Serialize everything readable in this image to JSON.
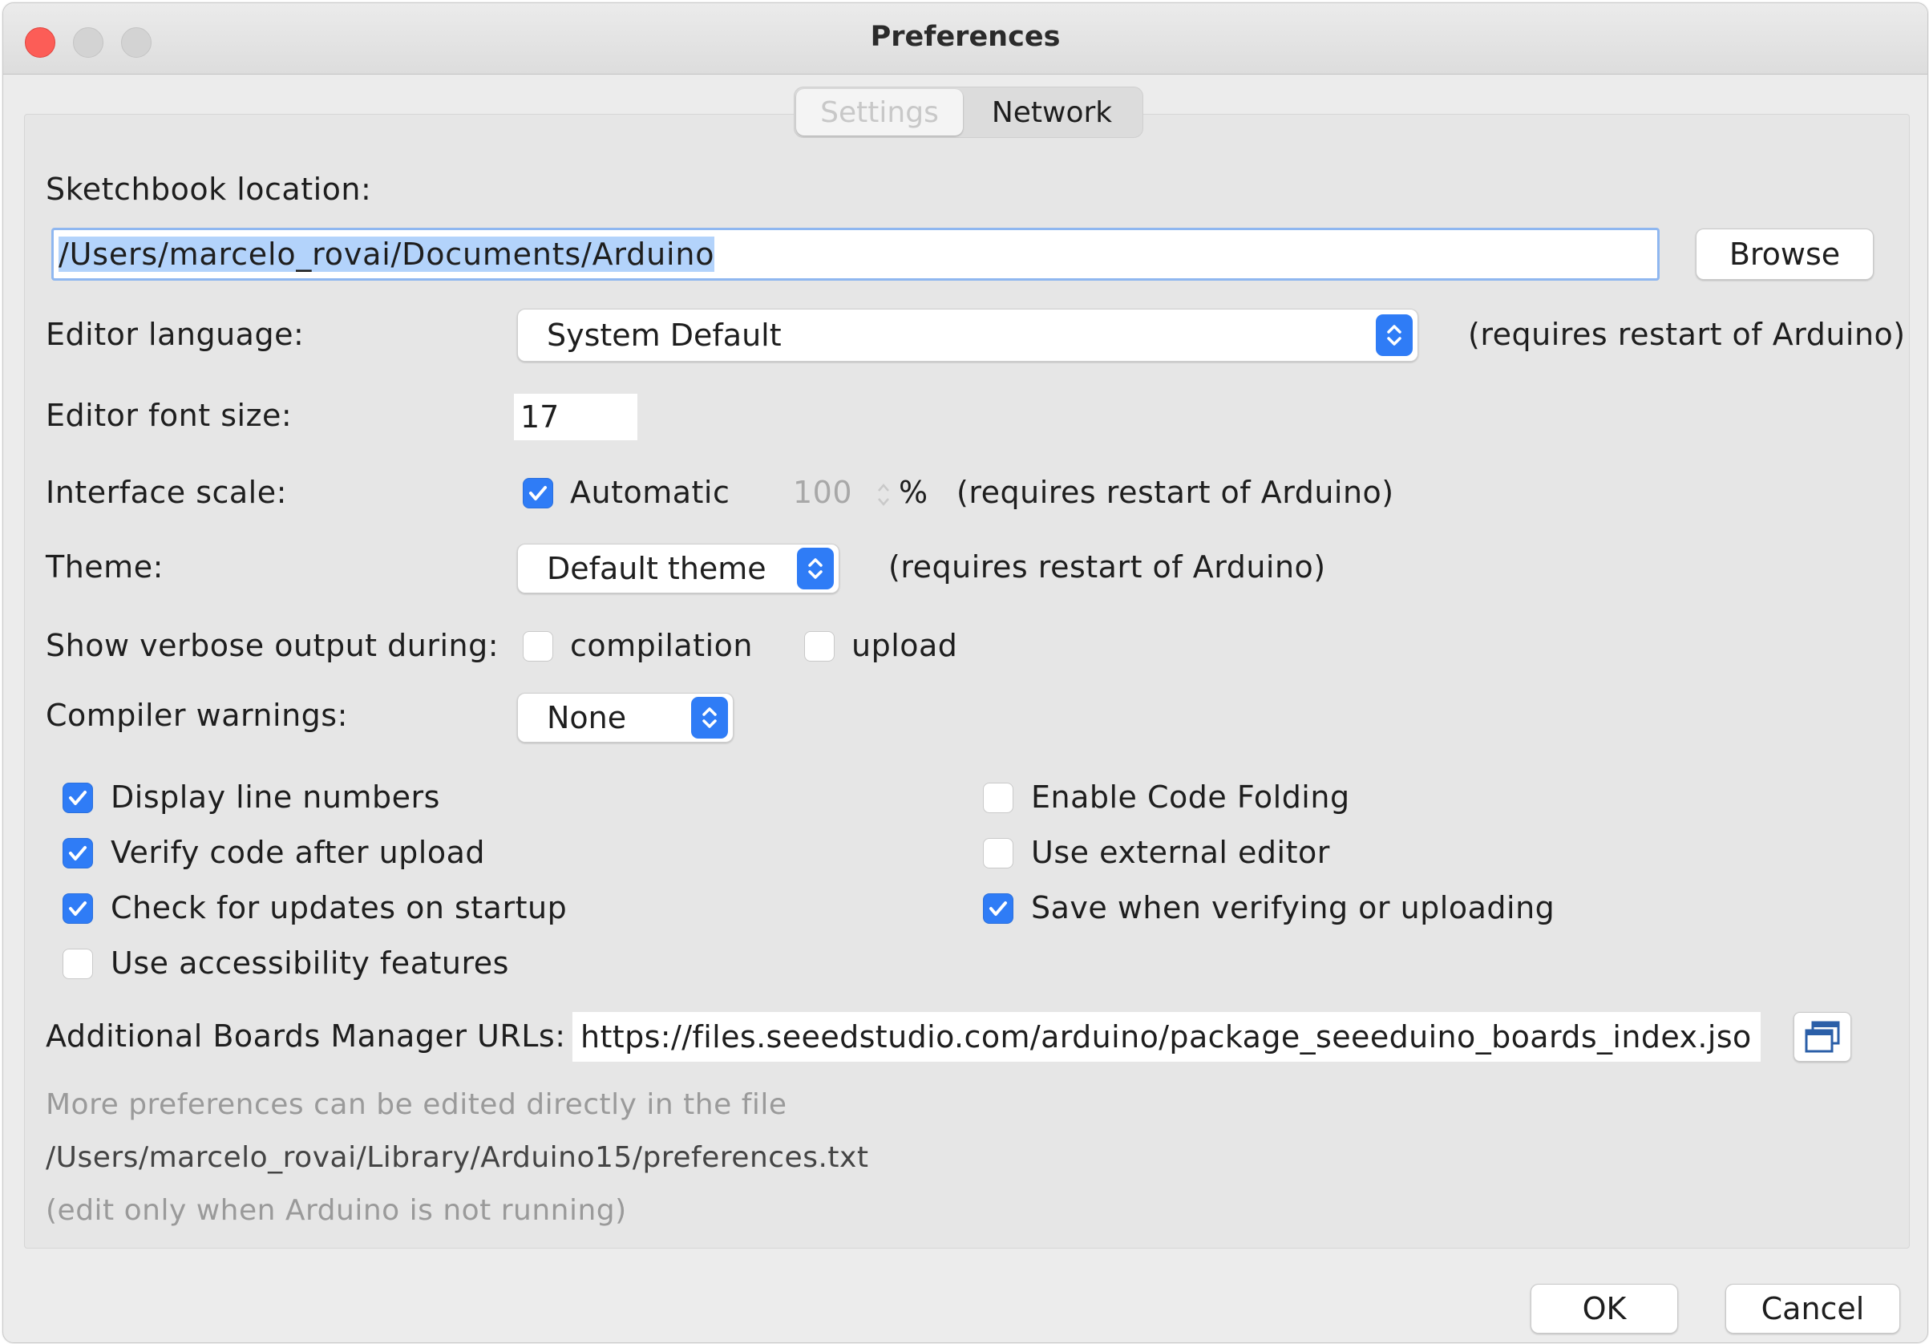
{
  "window": {
    "title": "Preferences"
  },
  "tabs": [
    {
      "label": "Settings",
      "selected": true
    },
    {
      "label": "Network",
      "selected": false
    }
  ],
  "sketchbook": {
    "label": "Sketchbook location:",
    "value": "/Users/marcelo_rovai/Documents/Arduino",
    "browse_label": "Browse"
  },
  "editor_language": {
    "label": "Editor language:",
    "value": "System Default",
    "note": "(requires restart of Arduino)"
  },
  "font_size": {
    "label": "Editor font size:",
    "value": "17"
  },
  "interface_scale": {
    "label": "Interface scale:",
    "automatic_label": "Automatic",
    "automatic_checked": true,
    "value": "100",
    "unit": "%",
    "note": "(requires restart of Arduino)"
  },
  "theme": {
    "label": "Theme:",
    "value": "Default theme",
    "note": "(requires restart of Arduino)"
  },
  "verbose": {
    "label": "Show verbose output during:",
    "compilation_label": "compilation",
    "compilation_checked": false,
    "upload_label": "upload",
    "upload_checked": false
  },
  "compiler_warnings": {
    "label": "Compiler warnings:",
    "value": "None"
  },
  "options": [
    {
      "label": "Display line numbers",
      "checked": true
    },
    {
      "label": "Verify code after upload",
      "checked": true
    },
    {
      "label": "Check for updates on startup",
      "checked": true
    },
    {
      "label": "Use accessibility features",
      "checked": false
    },
    {
      "label": "Enable Code Folding",
      "checked": false
    },
    {
      "label": "Use external editor",
      "checked": false
    },
    {
      "label": "Save when verifying or uploading",
      "checked": true
    }
  ],
  "boards_manager": {
    "label": "Additional Boards Manager URLs:",
    "value": "https://files.seeedstudio.com/arduino/package_seeeduino_boards_index.jso"
  },
  "info": {
    "line1": "More preferences can be edited directly in the file",
    "line2": "/Users/marcelo_rovai/Library/Arduino15/preferences.txt",
    "line3": "(edit only when Arduino is not running)"
  },
  "footer": {
    "ok_label": "OK",
    "cancel_label": "Cancel"
  },
  "colors": {
    "accent": "#2f7cf6",
    "close": "#fc5d57",
    "selection": "#b3d3fb"
  },
  "icons": [
    "close-icon",
    "minimize-icon",
    "zoom-icon",
    "chevron-updown-icon",
    "checkmark-icon",
    "expand-window-icon"
  ]
}
